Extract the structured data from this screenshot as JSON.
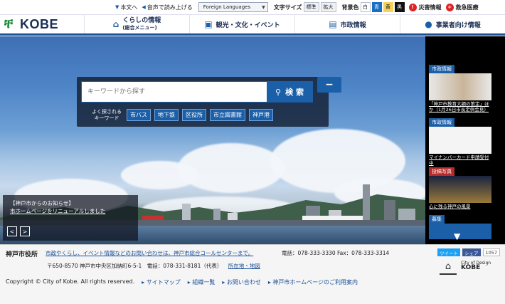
{
  "util": {
    "text_version": "本文へ",
    "read_aloud": "音声で読み上げる",
    "language": "Foreign Languages",
    "font_size_label": "文字サイズ",
    "font_size_standard": "標準",
    "font_size_large": "拡大",
    "bg_label": "背景色",
    "bg_white": "白",
    "bg_blue": "青",
    "bg_yellow": "黄",
    "bg_black": "黒",
    "disaster": "災害情報",
    "emergency": "救急医療"
  },
  "header": {
    "logo_text": "KOBE",
    "nav": [
      {
        "label": "くらしの情報",
        "sub": "(総合メニュー)",
        "icon": "house-icon"
      },
      {
        "label": "観光・文化・イベント",
        "sub": "",
        "icon": "briefcase-icon"
      },
      {
        "label": "市政情報",
        "sub": "",
        "icon": "building-icon"
      },
      {
        "label": "事業者向け情報",
        "sub": "",
        "icon": "person-icon"
      }
    ]
  },
  "search": {
    "placeholder": "キーワードから探す",
    "button": "検 索",
    "collapse": "−",
    "keywords_label": "よく探される\nキーワード",
    "keywords": [
      "市バス",
      "地下鉄",
      "区役所",
      "市立図書館",
      "神戸港"
    ]
  },
  "notice": {
    "title": "【神戸市からのお知らせ】",
    "link": "市ホームページをリニューアルしました",
    "prev": "<",
    "next": ">"
  },
  "right_panel": [
    {
      "tag": "市政情報",
      "caption": "「神戸市教育大綱の策定」ほか（1月26日市長定例会見）"
    },
    {
      "tag": "市政情報",
      "caption": "マイナンバーカード申請受付中"
    },
    {
      "tag": "投稿写真",
      "caption": "心に残る神戸の風景"
    },
    {
      "tag": "募集",
      "caption": ""
    }
  ],
  "footer": {
    "city": "神戸市役所",
    "contact_link": "市政やくらし、イベント情報などのお問い合わせは、神戸市総合コールセンターまで。",
    "tel": "電話：078-333-3330 Fax：078-333-3314",
    "address": "〒650-8570 神戸市中央区加納町6-5-1　電話：078-331-8181（代表）",
    "map_link": "所在地・地図",
    "copyright": "Copyright © City of Kobe. All rights reserved.",
    "links": [
      "サイトマップ",
      "組織一覧",
      "お問い合わせ",
      "神戸市ホームページのご利用案内"
    ],
    "tweet": "ツイート",
    "share": "シェア",
    "share_count": "1057",
    "unesco_title": "City of Design",
    "unesco_kobe": "KOBE"
  }
}
